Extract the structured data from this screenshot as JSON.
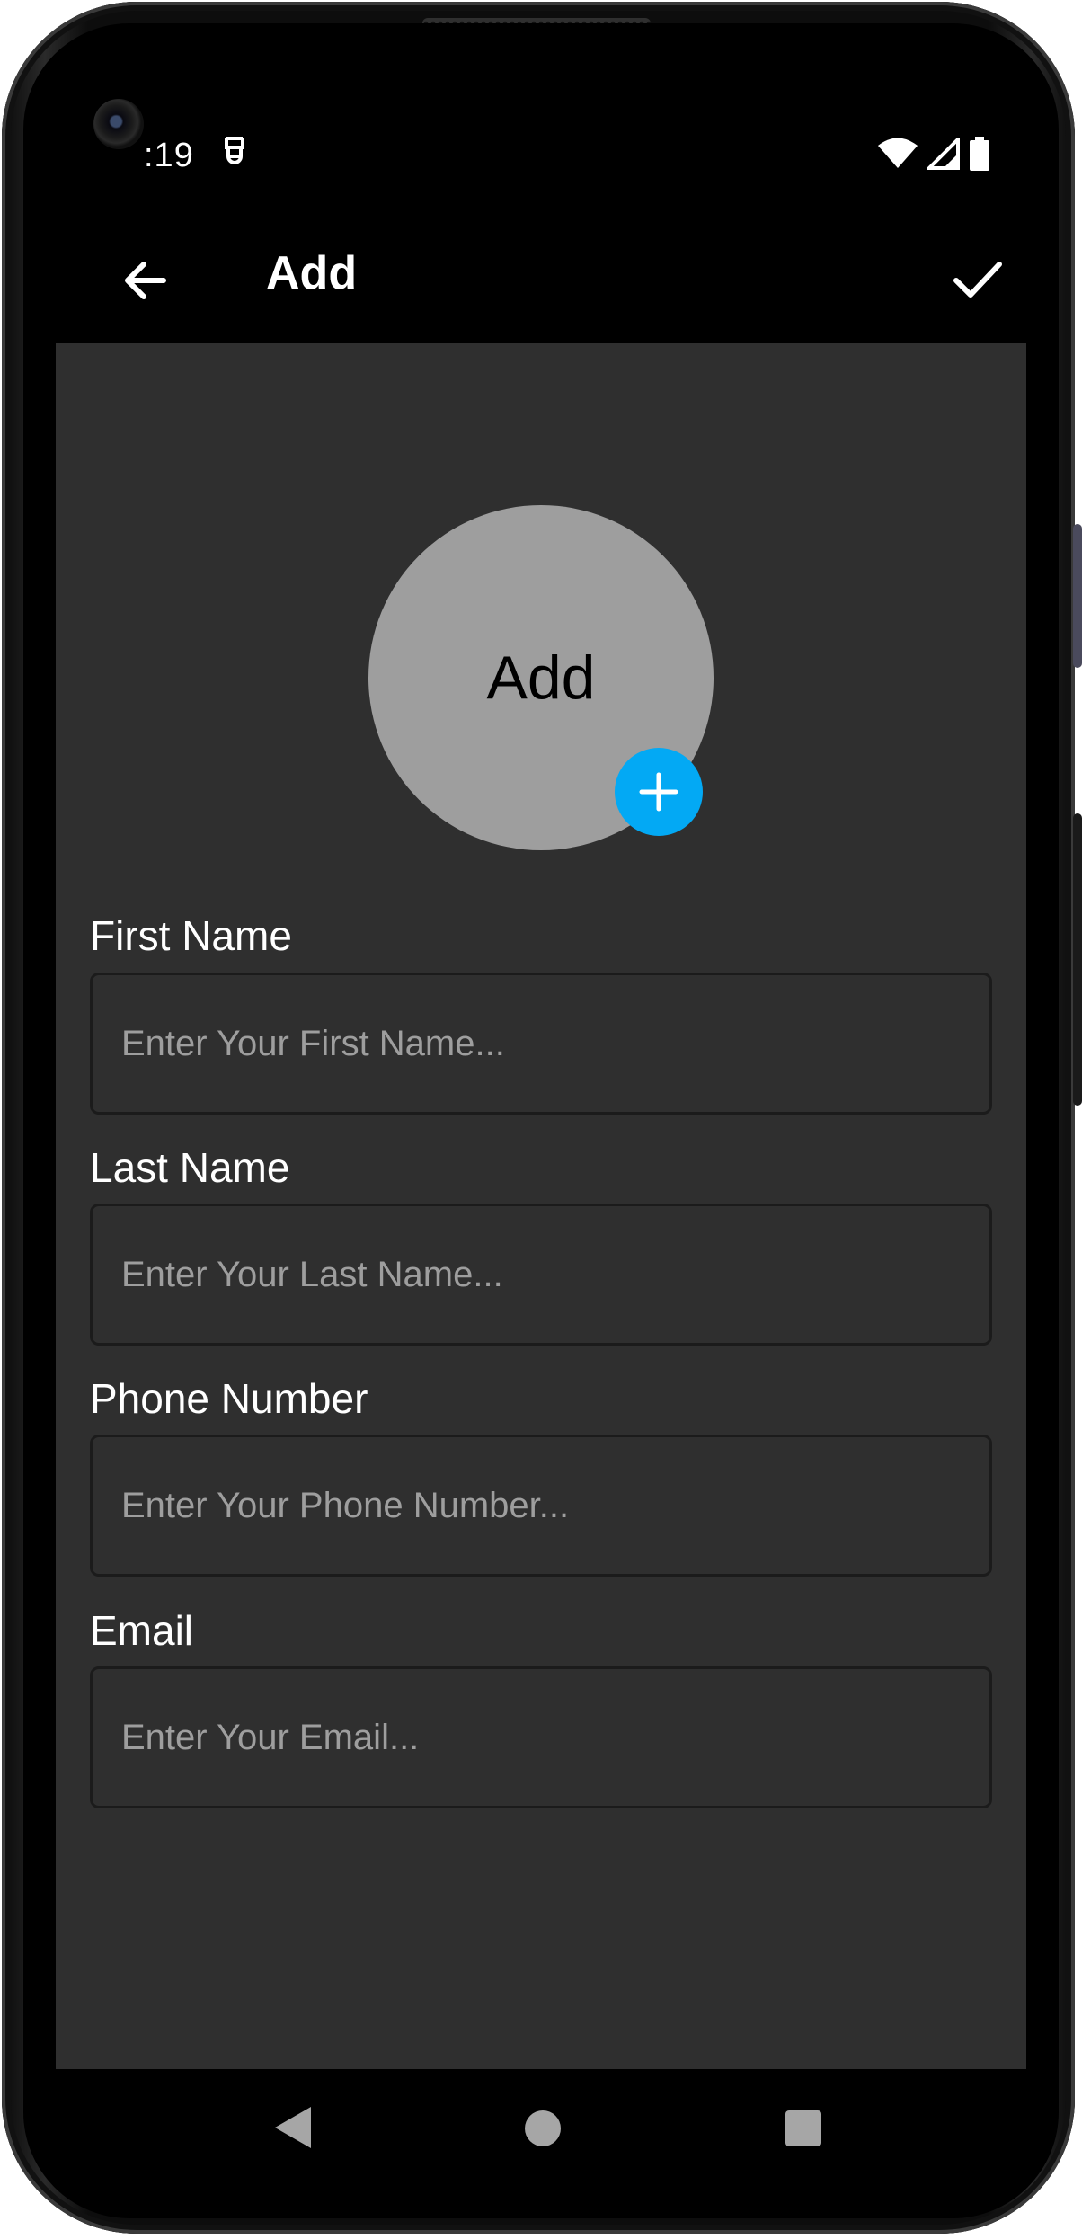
{
  "status_bar": {
    "time": ":19"
  },
  "app_bar": {
    "title": "Add"
  },
  "avatar": {
    "label": "Add"
  },
  "form": {
    "fields": [
      {
        "label": "First Name",
        "placeholder": "Enter Your First Name...",
        "value": ""
      },
      {
        "label": "Last Name",
        "placeholder": "Enter Your Last Name...",
        "value": ""
      },
      {
        "label": "Phone Number",
        "placeholder": "Enter Your Phone Number...",
        "value": ""
      },
      {
        "label": "Email",
        "placeholder": "Enter Your Email...",
        "value": ""
      }
    ]
  },
  "icons": {
    "back": "arrow-left-icon",
    "save": "check-icon",
    "add_photo": "plus-icon",
    "nav_back": "triangle-back-icon",
    "nav_home": "circle-home-icon",
    "nav_recents": "square-recents-icon"
  },
  "colors": {
    "accent": "#03a9f4",
    "background": "#2f2f2f",
    "app_bar": "#000000",
    "avatar": "#9e9e9e"
  }
}
